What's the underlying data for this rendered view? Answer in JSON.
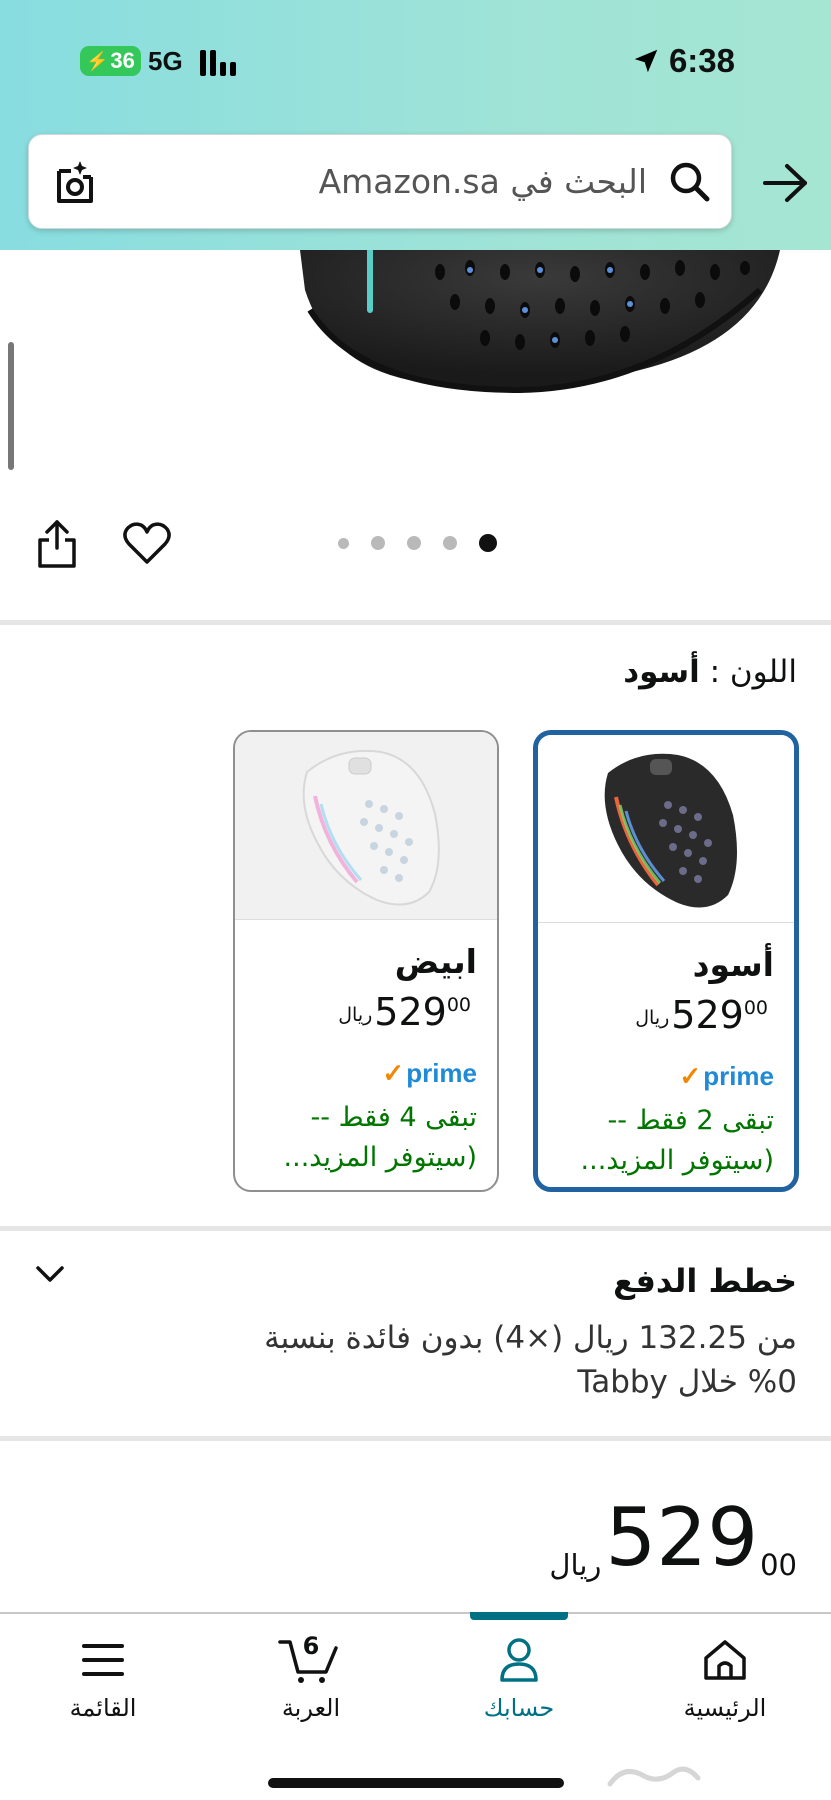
{
  "status_bar": {
    "battery": "36",
    "network": "5G",
    "time": "6:38"
  },
  "search": {
    "placeholder": "البحث في Amazon.sa"
  },
  "gallery": {
    "image_count": 5,
    "active_index": 4
  },
  "color": {
    "label": "اللون :",
    "value": "أسود"
  },
  "variants": [
    {
      "name": "أسود",
      "price_whole": "529",
      "price_fraction": "00",
      "currency": "ريال",
      "prime": "prime",
      "stock": "تبقى 2 فقط -- (سيتوفر المزيد...",
      "selected": true
    },
    {
      "name": "ابيض",
      "price_whole": "529",
      "price_fraction": "00",
      "currency": "ريال",
      "prime": "prime",
      "stock": "تبقى 4 فقط -- (سيتوفر المزيد...",
      "selected": false
    }
  ],
  "payment_plans": {
    "title": "خطط الدفع",
    "description": "من 132.25 ريال (×4) بدون فائدة بنسبة 0% خلال Tabby"
  },
  "price": {
    "whole": "529",
    "fraction": "00",
    "currency": "ريال"
  },
  "bottom_nav": {
    "home": "الرئيسية",
    "account": "حسابك",
    "cart": "العربة",
    "cart_count": "6",
    "menu": "القائمة"
  },
  "colors": {
    "accent": "#007185",
    "selected_border": "#2162a1",
    "stock_green": "#007600",
    "prime_blue": "#1f8ad6",
    "prime_orange": "#f08804"
  }
}
